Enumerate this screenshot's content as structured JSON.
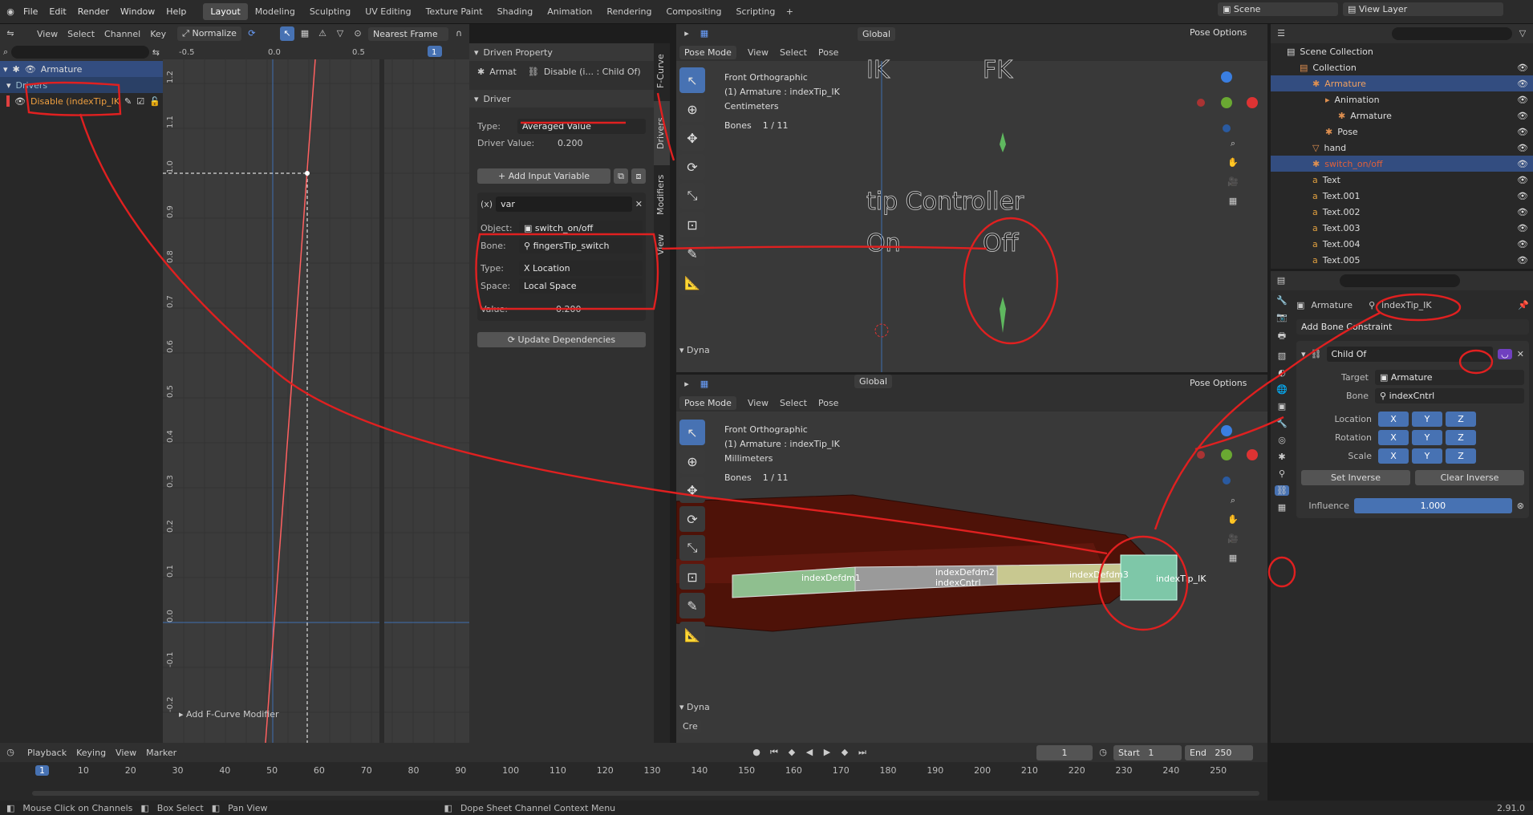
{
  "topbar": {
    "menus": [
      "File",
      "Edit",
      "Render",
      "Window",
      "Help"
    ],
    "workspaces": [
      "Layout",
      "Modeling",
      "Sculpting",
      "UV Editing",
      "Texture Paint",
      "Shading",
      "Animation",
      "Rendering",
      "Compositing",
      "Scripting"
    ],
    "active_ws": "Layout",
    "scene": "Scene",
    "view_layer": "View Layer"
  },
  "graph": {
    "menus": [
      "View",
      "Select",
      "Channel",
      "Key"
    ],
    "normalize": "Normalize",
    "interp": "Nearest Frame",
    "xticks": [
      "-0.5",
      "0.0",
      "0.5"
    ],
    "frame_badge": "1",
    "yticks": [
      "1.2",
      "1.1",
      "1.0",
      "0.9",
      "0.8",
      "0.7",
      "0.6",
      "0.5",
      "0.4",
      "0.3",
      "0.2",
      "0.1",
      "0.0",
      "-0.1",
      "-0.2"
    ],
    "add_modifier": "Add F-Curve Modifier"
  },
  "channels": {
    "armature": "Armature",
    "drivers": "Drivers",
    "fcurve": "Disable (indexTip_IK"
  },
  "driver": {
    "driven_title": "Driven Property",
    "driven_obj": "Armat",
    "driven_prop": "Disable (i... : Child Of)",
    "section": "Driver",
    "type_label": "Type:",
    "type_value": "Averaged Value",
    "dv_label": "Driver Value:",
    "dv_value": "0.200",
    "add_var": "Add Input Variable",
    "var_name": "var",
    "var_type": "(x)",
    "obj_label": "Object:",
    "obj_value": "switch_on/off",
    "bone_label": "Bone:",
    "bone_value": "fingersTip_switch",
    "ttype_label": "Type:",
    "ttype_value": "X Location",
    "space_label": "Space:",
    "space_value": "Local Space",
    "value_label": "Value:",
    "value_value": "0.200",
    "update": "Update Dependencies",
    "tabs": [
      "F-Curve",
      "Drivers",
      "Modifiers",
      "View"
    ]
  },
  "vp_top": {
    "mode": "Pose Mode",
    "menus": [
      "View",
      "Select",
      "Pose"
    ],
    "orient": "Global",
    "options": "Pose Options",
    "info1": "Front Orthographic",
    "info2": "(1) Armature : indexTip_IK",
    "info3": "Centimeters",
    "bones_label": "Bones",
    "bones_value": "1 / 11",
    "ik": "IK",
    "fk": "FK",
    "ctrl": "tip Controller",
    "on": "On",
    "off": "Off",
    "dyna": "Dyna"
  },
  "vp_bot": {
    "mode": "Pose Mode",
    "menus": [
      "View",
      "Select",
      "Pose"
    ],
    "orient": "Global",
    "options": "Pose Options",
    "info1": "Front Orthographic",
    "info2": "(1) Armature : indexTip_IK",
    "info3": "Millimeters",
    "bones_label": "Bones",
    "bones_value": "1 / 11",
    "bone_names": [
      "indexDefdm1",
      "indexDefdm2",
      "indexCntrl",
      "indexDefdm3",
      "indexTip_IK"
    ],
    "dyna": "Dyna",
    "cre": "Cre"
  },
  "outliner": {
    "title": "Scene Collection",
    "items": [
      {
        "label": "Collection",
        "indent": 1,
        "color": "#ddd"
      },
      {
        "label": "Armature",
        "indent": 2,
        "color": "#f0a060",
        "sel": true
      },
      {
        "label": "Animation",
        "indent": 3,
        "color": "#ddd"
      },
      {
        "label": "Armature",
        "indent": 4,
        "color": "#ddd"
      },
      {
        "label": "Pose",
        "indent": 3,
        "color": "#ddd"
      },
      {
        "label": "hand",
        "indent": 2,
        "color": "#ddd"
      },
      {
        "label": "switch_on/off",
        "indent": 2,
        "color": "#e0603a",
        "sel": true
      },
      {
        "label": "Text",
        "indent": 2,
        "color": "#ddd"
      },
      {
        "label": "Text.001",
        "indent": 2,
        "color": "#ddd"
      },
      {
        "label": "Text.002",
        "indent": 2,
        "color": "#ddd"
      },
      {
        "label": "Text.003",
        "indent": 2,
        "color": "#ddd"
      },
      {
        "label": "Text.004",
        "indent": 2,
        "color": "#ddd"
      },
      {
        "label": "Text.005",
        "indent": 2,
        "color": "#ddd"
      }
    ]
  },
  "props": {
    "armature": "Armature",
    "bone": "indexTip_IK",
    "add_constraint": "Add Bone Constraint",
    "constraint": "Child Of",
    "target_label": "Target",
    "target_value": "Armature",
    "bone_label": "Bone",
    "bone_value": "indexCntrl",
    "loc": "Location",
    "rot": "Rotation",
    "scale": "Scale",
    "x": "X",
    "y": "Y",
    "z": "Z",
    "set_inverse": "Set Inverse",
    "clear_inverse": "Clear Inverse",
    "influence_label": "Influence",
    "influence_value": "1.000"
  },
  "timeline": {
    "menus": [
      "Playback",
      "Keying",
      "View",
      "Marker"
    ],
    "current": "1",
    "start_label": "Start",
    "start": "1",
    "end_label": "End",
    "end": "250",
    "ticks": [
      "1",
      "10",
      "20",
      "30",
      "40",
      "50",
      "60",
      "70",
      "80",
      "90",
      "100",
      "110",
      "120",
      "130",
      "140",
      "150",
      "160",
      "170",
      "180",
      "190",
      "200",
      "210",
      "220",
      "230",
      "240",
      "250"
    ]
  },
  "status": {
    "s1": "Mouse Click on Channels",
    "s2": "Box Select",
    "s3": "Pan View",
    "s4": "Dope Sheet Channel Context Menu",
    "version": "2.91.0"
  }
}
